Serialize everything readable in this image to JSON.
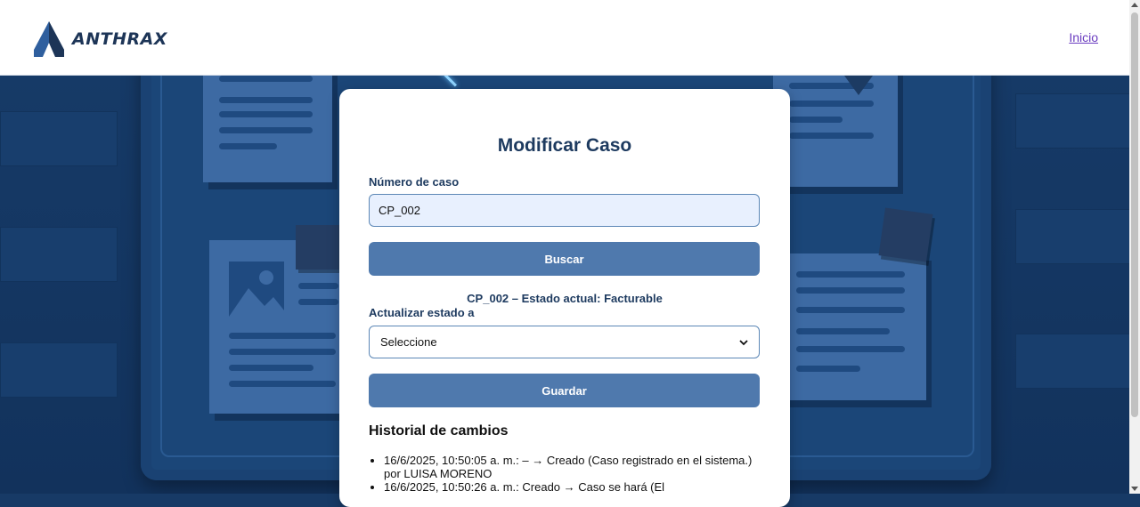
{
  "header": {
    "brand": "ANTHRAX",
    "nav_link": "Inicio"
  },
  "form": {
    "title": "Modificar Caso",
    "case_number_label": "Número de caso",
    "case_number_value": "CP_002",
    "search_button": "Buscar",
    "status_text": "CP_002 – Estado actual: Facturable",
    "update_label": "Actualizar estado a",
    "update_select_value": "Seleccione",
    "save_button": "Guardar"
  },
  "history": {
    "title": "Historial de cambios",
    "items": [
      "16/6/2025, 10:50:05 a. m.: – → Creado (Caso registrado en el sistema.) por LUISA MORENO",
      "16/6/2025, 10:50:26 a. m.: Creado → Caso se hará (El"
    ]
  },
  "colors": {
    "brand": "#1d3557",
    "button": "#4f79ad",
    "background": "#173a66"
  }
}
